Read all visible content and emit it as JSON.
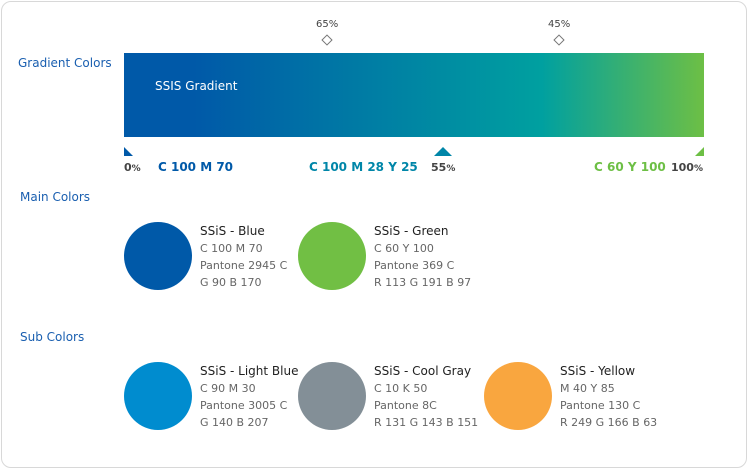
{
  "sections": {
    "gradient": "Gradient Colors",
    "main": "Main Colors",
    "sub": "Sub Colors"
  },
  "gradient": {
    "title": "SSIS Gradient",
    "colors": {
      "blue": "#0059A8",
      "teal": "#00A0A0",
      "green": "#6DBF45"
    },
    "top_stops": [
      {
        "value": "65",
        "unit": "%"
      },
      {
        "value": "45",
        "unit": "%"
      }
    ],
    "positions": [
      {
        "value": "0",
        "unit": "%"
      },
      {
        "value": "55",
        "unit": "%"
      },
      {
        "value": "100",
        "unit": "%"
      }
    ],
    "cmyk_labels": [
      {
        "text": "C 100 M 70",
        "color": "#0059A8"
      },
      {
        "text": "C 100 M 28 Y 25",
        "color": "#0086A8"
      },
      {
        "text": "C 60 Y 100",
        "color": "#6DBF45"
      }
    ]
  },
  "main_colors": [
    {
      "name": "SSiS - Blue",
      "color": "#0059A8",
      "lines": [
        "C 100 M 70",
        "Pantone 2945 C",
        "G 90 B 170"
      ]
    },
    {
      "name": "SSiS - Green",
      "color": "#71BF44",
      "lines": [
        "C 60 Y 100",
        "Pantone 369 C",
        "R 113 G 191 B 97"
      ]
    }
  ],
  "sub_colors": [
    {
      "name": "SSiS - Light Blue",
      "color": "#008CCF",
      "lines": [
        "C 90 M 30",
        "Pantone 3005 C",
        "G 140 B 207"
      ]
    },
    {
      "name": "SSiS - Cool Gray",
      "color": "#838F97",
      "lines": [
        "C 10 K 50",
        "Pantone 8C",
        "R 131 G 143 B 151"
      ]
    },
    {
      "name": "SSiS - Yellow",
      "color": "#F9A63F",
      "lines": [
        "M 40 Y 85",
        "Pantone 130 C",
        "R 249 G 166 B 63"
      ]
    }
  ]
}
